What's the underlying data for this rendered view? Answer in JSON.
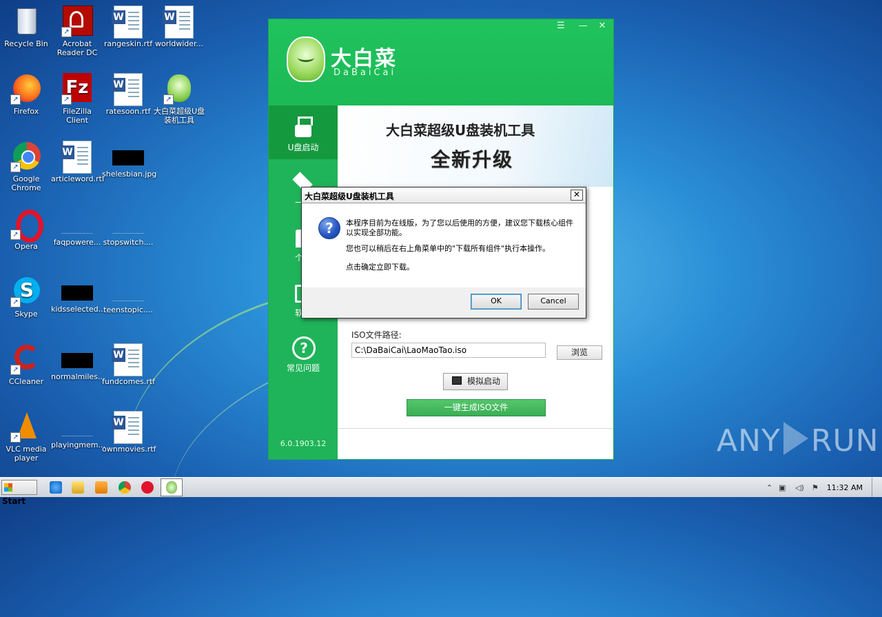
{
  "desktop": {
    "icons": [
      {
        "label": "Recycle Bin"
      },
      {
        "label": "Acrobat Reader DC"
      },
      {
        "label": "rangeskin.rtf"
      },
      {
        "label": "worldwider..."
      },
      {
        "label": "Firefox"
      },
      {
        "label": "FileZilla Client"
      },
      {
        "label": "ratesoon.rtf"
      },
      {
        "label": "大白菜超级U盘装机工具"
      },
      {
        "label": "Google Chrome"
      },
      {
        "label": "articleword.rtf"
      },
      {
        "label": "shelesbian.jpg"
      },
      {
        "label": "Opera"
      },
      {
        "label": "faqpowere..."
      },
      {
        "label": "stopswitch...."
      },
      {
        "label": "Skype"
      },
      {
        "label": "kidsselected..."
      },
      {
        "label": "teenstopic...."
      },
      {
        "label": "CCleaner"
      },
      {
        "label": "normalmiles..."
      },
      {
        "label": "fundcomes.rtf"
      },
      {
        "label": "VLC media player"
      },
      {
        "label": "playingmem..."
      },
      {
        "label": "ownmovies.rtf"
      }
    ]
  },
  "app": {
    "brand": "大白菜",
    "brand_sub": "DaBaiCai",
    "controls": {
      "menu": "☰",
      "minimize": "—",
      "close": "✕"
    },
    "sidebar": [
      {
        "label": "U盘启动",
        "icon": "usb-icon"
      },
      {
        "label": "一键",
        "icon": "layers-icon"
      },
      {
        "label": "个性",
        "icon": "shirt-icon"
      },
      {
        "label": "软件",
        "icon": "software-icon"
      },
      {
        "label": "常见问题",
        "icon": "question-icon"
      }
    ],
    "version": "6.0.1903.12",
    "banner_title": "大白菜超级U盘装机工具",
    "banner_sub": "全新升级",
    "iso_label": "ISO文件路径:",
    "iso_path": "C:\\DaBaiCai\\LaoMaoTao.iso",
    "browse": "浏览",
    "simulate": "模拟启动",
    "generate": "一键生成ISO文件"
  },
  "dialog": {
    "title": "大白菜超级U盘装机工具",
    "close": "✕",
    "msg1": "本程序目前为在线版，为了您以后使用的方便，建议您下载核心组件以实现全部功能。",
    "msg2": "您也可以稍后在右上角菜单中的\"下载所有组件\"执行本操作。",
    "msg3": "点击确定立即下载。",
    "ok": "OK",
    "cancel": "Cancel"
  },
  "taskbar": {
    "start": "Start",
    "clock": "11:32 AM"
  },
  "watermark": {
    "left": "ANY",
    "right": "RUN"
  }
}
